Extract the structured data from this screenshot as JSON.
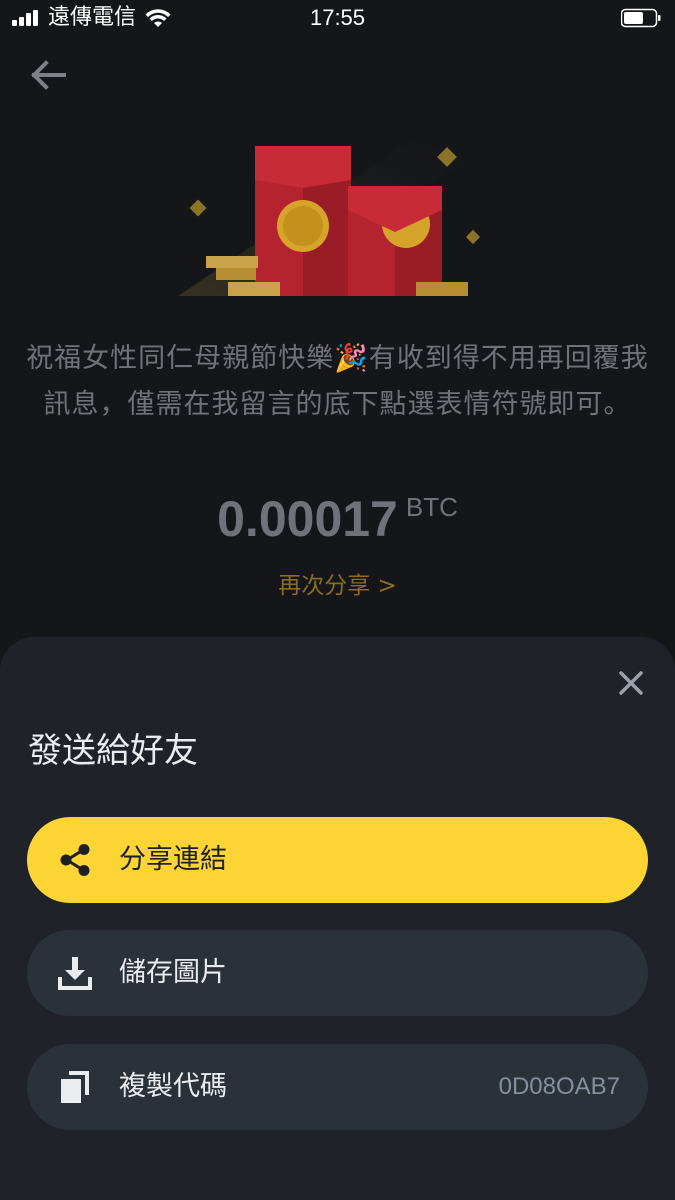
{
  "status_bar": {
    "carrier": "遠傳電信",
    "time": "17:55"
  },
  "hero": {
    "message": "祝福女性同仁母親節快樂🎉有收到得不用再回覆我訊息，僅需在我留言的底下點選表情符號即可。",
    "amount": "0.00017",
    "currency": "BTC",
    "share_again": "再次分享 >"
  },
  "sheet": {
    "title": "發送給好友",
    "actions": [
      {
        "label": "分享連結",
        "icon": "share-icon"
      },
      {
        "label": "儲存圖片",
        "icon": "download-icon"
      },
      {
        "label": "複製代碼",
        "icon": "copy-icon",
        "code": "0D08OAB7"
      }
    ]
  },
  "colors": {
    "accent": "#fcd535",
    "background": "#141619",
    "sheet": "#1f2329",
    "button": "#2b3139",
    "share_again": "#8a6d1e"
  }
}
